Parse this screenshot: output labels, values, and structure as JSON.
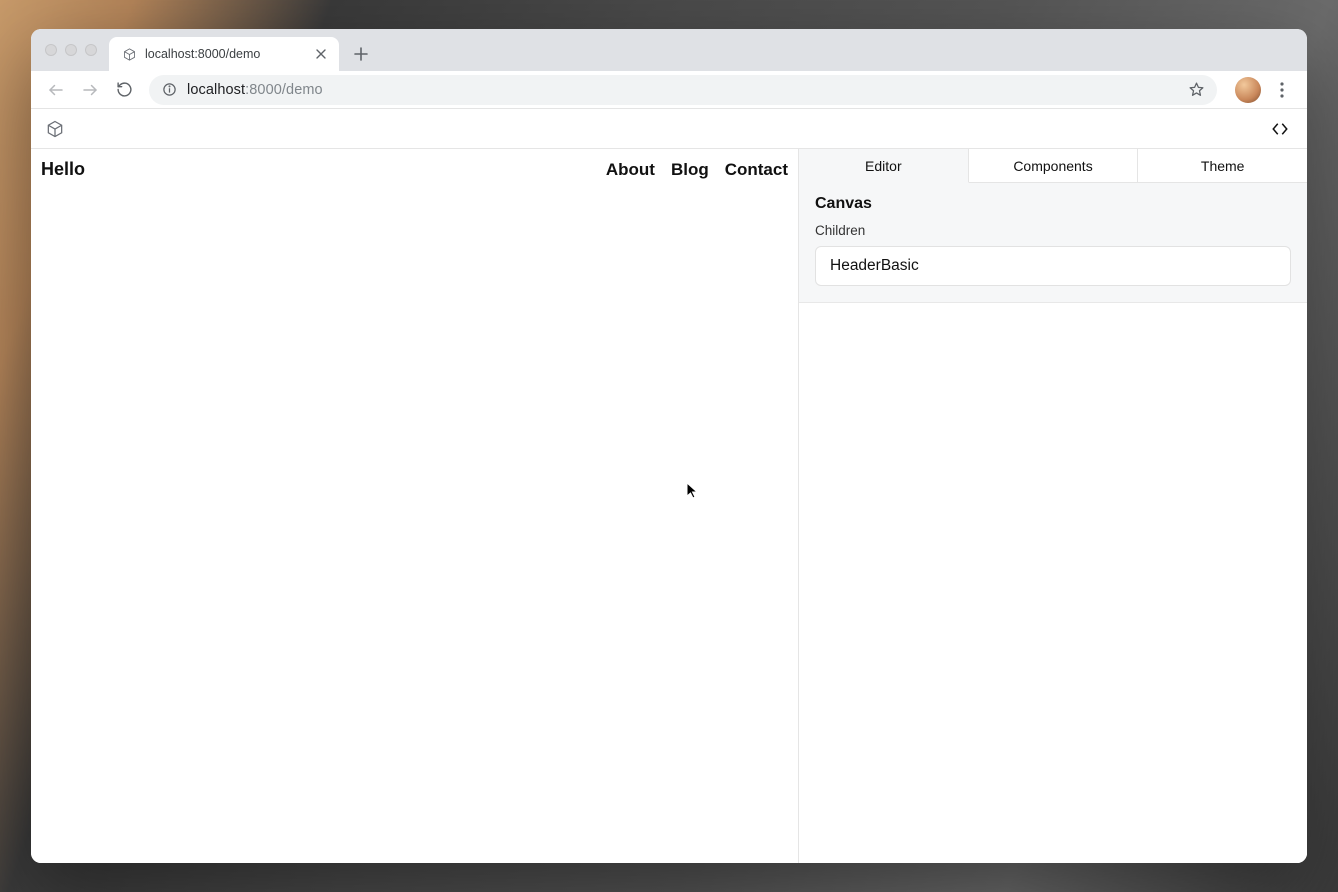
{
  "browser": {
    "tab_title": "localhost:8000/demo",
    "url_host": "localhost",
    "url_port_path": ":8000/demo"
  },
  "preview": {
    "brand": "Hello",
    "nav": [
      "About",
      "Blog",
      "Contact"
    ]
  },
  "panel": {
    "tabs": [
      "Editor",
      "Components",
      "Theme"
    ],
    "active_tab_index": 0,
    "section_title": "Canvas",
    "children_label": "Children",
    "children": [
      "HeaderBasic"
    ]
  }
}
